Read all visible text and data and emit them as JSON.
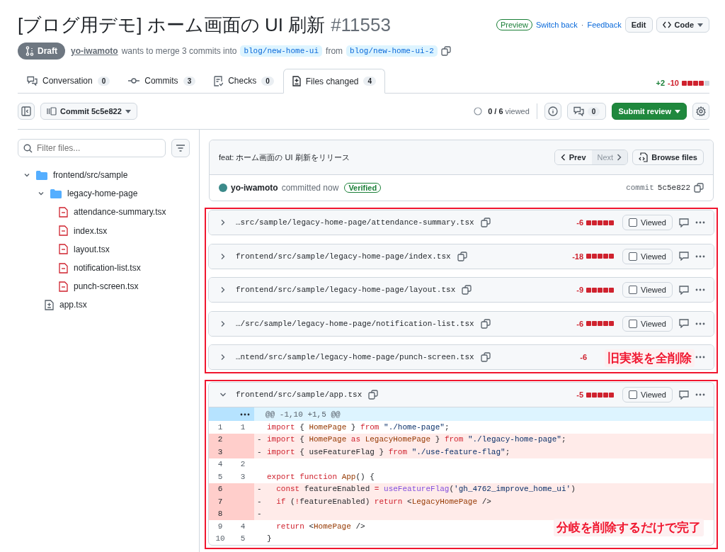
{
  "title": {
    "text": "[ブログ用デモ] ホーム画面の UI 刷新",
    "number": "#11553"
  },
  "header_actions": {
    "badge": "Preview",
    "links": [
      "Switch back",
      "Feedback"
    ],
    "separator": "·",
    "edit": "Edit",
    "code": "Code"
  },
  "status": {
    "state": "Draft",
    "author": "yo-iwamoto",
    "text": "wants to merge 3 commits into",
    "base": "blog/new-home-ui",
    "from": "from",
    "head": "blog/new-home-ui-2"
  },
  "tabs": [
    {
      "label": "Conversation",
      "count": "0",
      "kind": "conversation",
      "selected": false
    },
    {
      "label": "Commits",
      "count": "3",
      "kind": "commit",
      "selected": false
    },
    {
      "label": "Checks",
      "count": "0",
      "kind": "checks",
      "selected": false
    },
    {
      "label": "Files changed",
      "count": "4",
      "kind": "files",
      "selected": true
    }
  ],
  "diffstat": {
    "additions": "+2",
    "deletions": "-10"
  },
  "toolbar": {
    "commit": "Commit 5c5e822",
    "viewed_count": "0 / 6",
    "viewed_label": "viewed",
    "comments_count": "0",
    "submit": "Submit review"
  },
  "sidebar": {
    "filter_placeholder": "Filter files...",
    "tree": [
      {
        "name": "frontend/src/sample",
        "kind": "folder",
        "expanded": true,
        "children": [
          {
            "name": "legacy-home-page",
            "kind": "folder",
            "expanded": true,
            "children": [
              {
                "name": "attendance-summary.tsx",
                "kind": "deleted"
              },
              {
                "name": "index.tsx",
                "kind": "deleted"
              },
              {
                "name": "layout.tsx",
                "kind": "deleted"
              },
              {
                "name": "notification-list.tsx",
                "kind": "deleted"
              },
              {
                "name": "punch-screen.tsx",
                "kind": "deleted"
              }
            ]
          },
          {
            "name": "app.tsx",
            "kind": "modified"
          }
        ]
      }
    ]
  },
  "commit": {
    "message": "feat: ホーム画面の UI 刷新をリリース",
    "prev": "Prev",
    "next": "Next",
    "next_disabled": true,
    "browse": "Browse files",
    "author": "yo-iwamoto",
    "action": "committed now",
    "verified": "Verified",
    "label": "commit",
    "sha": "5c5e822"
  },
  "file_groups": [
    {
      "note": "旧実装を全削除",
      "files": [
        {
          "path": "…src/sample/legacy-home-page/attendance-summary.tsx",
          "deletions": "-6",
          "expanded": false,
          "viewed": false,
          "viewed_label": "Viewed"
        },
        {
          "path": "frontend/src/sample/legacy-home-page/index.tsx",
          "deletions": "-18",
          "expanded": false,
          "viewed": false,
          "viewed_label": "Viewed"
        },
        {
          "path": "frontend/src/sample/legacy-home-page/layout.tsx",
          "deletions": "-9",
          "expanded": false,
          "viewed": false,
          "viewed_label": "Viewed"
        },
        {
          "path": "…/src/sample/legacy-home-page/notification-list.tsx",
          "deletions": "-6",
          "expanded": false,
          "viewed": false,
          "viewed_label": "Viewed"
        },
        {
          "path": "…ntend/src/sample/legacy-home-page/punch-screen.tsx",
          "deletions": "-6",
          "expanded": false
        }
      ]
    },
    {
      "note": "分岐を削除するだけで完了",
      "files": [
        {
          "path": "frontend/src/sample/app.tsx",
          "deletions": "-5",
          "expanded": true,
          "viewed": false,
          "viewed_label": "Viewed",
          "diff": {
            "hunk": "@@ -1,10 +1,5 @@",
            "lines": [
              {
                "old": "1",
                "new": "1",
                "kind": "context",
                "tokens": [
                  {
                    "t": "import",
                    "kind": "keyword"
                  },
                  {
                    "t": " { ",
                    "kind": "plain"
                  },
                  {
                    "t": "HomePage",
                    "kind": "entity"
                  },
                  {
                    "t": " } ",
                    "kind": "plain"
                  },
                  {
                    "t": "from",
                    "kind": "keyword"
                  },
                  {
                    "t": " \"./home-page\"",
                    "kind": "string"
                  },
                  {
                    "t": ";",
                    "kind": "plain"
                  }
                ]
              },
              {
                "old": "2",
                "kind": "deleted",
                "sign": "-",
                "tokens": [
                  {
                    "t": "import",
                    "kind": "keyword"
                  },
                  {
                    "t": " { ",
                    "kind": "plain"
                  },
                  {
                    "t": "HomePage",
                    "kind": "entity"
                  },
                  {
                    "t": " as",
                    "kind": "keyword"
                  },
                  {
                    "t": " LegacyHomePage",
                    "kind": "entity"
                  },
                  {
                    "t": " } ",
                    "kind": "plain"
                  },
                  {
                    "t": "from",
                    "kind": "keyword"
                  },
                  {
                    "t": " \"./legacy-home-page\"",
                    "kind": "string"
                  },
                  {
                    "t": ";",
                    "kind": "plain"
                  }
                ]
              },
              {
                "old": "3",
                "kind": "deleted",
                "sign": "-",
                "tokens": [
                  {
                    "t": "import",
                    "kind": "keyword"
                  },
                  {
                    "t": " { useFeatureFlag } ",
                    "kind": "plain"
                  },
                  {
                    "t": "from",
                    "kind": "keyword"
                  },
                  {
                    "t": " \"./use-feature-flag\"",
                    "kind": "string"
                  },
                  {
                    "t": ";",
                    "kind": "plain"
                  }
                ]
              },
              {
                "old": "4",
                "new": "2",
                "kind": "context"
              },
              {
                "old": "5",
                "new": "3",
                "kind": "context",
                "tokens": [
                  {
                    "t": "export",
                    "kind": "keyword"
                  },
                  {
                    "t": " function",
                    "kind": "keyword"
                  },
                  {
                    "t": " App",
                    "kind": "entity"
                  },
                  {
                    "t": "() {",
                    "kind": "plain"
                  }
                ]
              },
              {
                "old": "6",
                "kind": "deleted",
                "sign": "-",
                "tokens": [
                  {
                    "t": "  const",
                    "kind": "keyword"
                  },
                  {
                    "t": " featureEnabled ",
                    "kind": "plain"
                  },
                  {
                    "t": "=",
                    "kind": "keyword"
                  },
                  {
                    "t": " useFeatureFlag",
                    "kind": "function"
                  },
                  {
                    "t": "(",
                    "kind": "plain"
                  },
                  {
                    "t": "'gh_4762_improve_home_ui'",
                    "kind": "string"
                  },
                  {
                    "t": ")",
                    "kind": "plain"
                  }
                ]
              },
              {
                "old": "7",
                "kind": "deleted",
                "sign": "-",
                "tokens": [
                  {
                    "t": "  if",
                    "kind": "keyword"
                  },
                  {
                    "t": " (",
                    "kind": "plain"
                  },
                  {
                    "t": "!",
                    "kind": "keyword"
                  },
                  {
                    "t": "featureEnabled) ",
                    "kind": "plain"
                  },
                  {
                    "t": "return",
                    "kind": "keyword"
                  },
                  {
                    "t": " <",
                    "kind": "plain"
                  },
                  {
                    "t": "LegacyHomePage",
                    "kind": "entity"
                  },
                  {
                    "t": " />",
                    "kind": "plain"
                  }
                ]
              },
              {
                "old": "8",
                "kind": "deleted",
                "sign": "-"
              },
              {
                "old": "9",
                "new": "4",
                "kind": "context",
                "tokens": [
                  {
                    "t": "  return",
                    "kind": "keyword"
                  },
                  {
                    "t": " <",
                    "kind": "plain"
                  },
                  {
                    "t": "HomePage",
                    "kind": "entity"
                  },
                  {
                    "t": " />",
                    "kind": "plain"
                  }
                ]
              },
              {
                "old": "10",
                "new": "5",
                "kind": "context",
                "tokens": [
                  {
                    "t": "}",
                    "kind": "plain"
                  }
                ]
              }
            ]
          }
        }
      ]
    }
  ]
}
